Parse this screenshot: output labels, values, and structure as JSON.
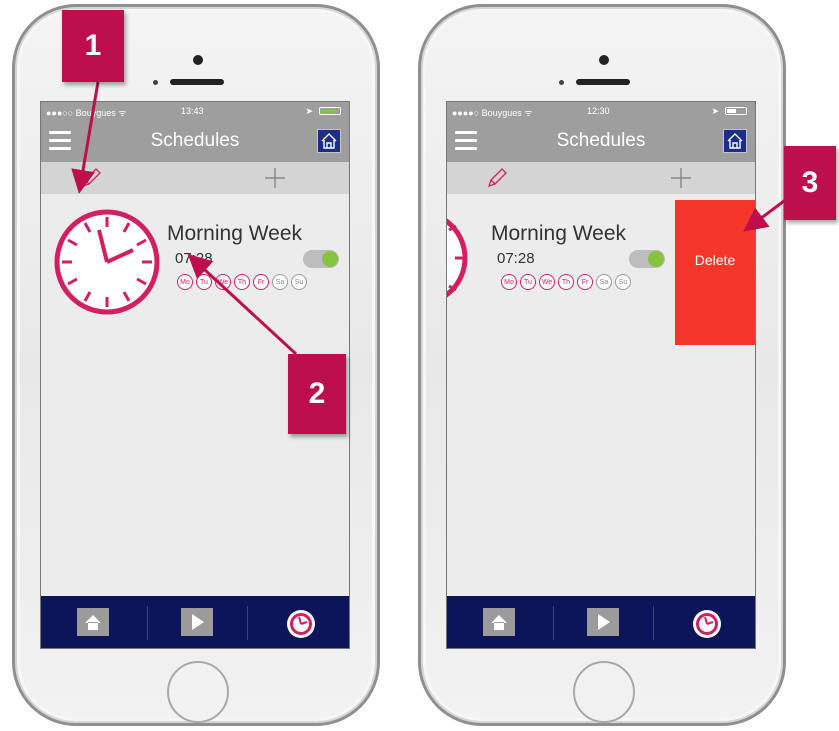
{
  "left_phone": {
    "status": {
      "carrier": "●●●○○ Bouygues ᯤ",
      "time": "13:43"
    },
    "header": {
      "title": "Schedules"
    },
    "schedule": {
      "name": "Morning Week",
      "time": "07:28",
      "enabled": true,
      "days": [
        {
          "label": "Mo",
          "active": true
        },
        {
          "label": "Tu",
          "active": true
        },
        {
          "label": "We",
          "active": true
        },
        {
          "label": "Th",
          "active": true
        },
        {
          "label": "Fr",
          "active": true
        },
        {
          "label": "Sa",
          "active": false
        },
        {
          "label": "Su",
          "active": false
        }
      ]
    }
  },
  "right_phone": {
    "status": {
      "carrier": "●●●●○ Bouygues ᯤ",
      "time": "12:30"
    },
    "header": {
      "title": "Schedules"
    },
    "schedule": {
      "name": "Morning Week",
      "time": "07:28",
      "enabled": true,
      "days": [
        {
          "label": "Mo",
          "active": true
        },
        {
          "label": "Tu",
          "active": true
        },
        {
          "label": "We",
          "active": true
        },
        {
          "label": "Th",
          "active": true
        },
        {
          "label": "Fr",
          "active": true
        },
        {
          "label": "Sa",
          "active": false
        },
        {
          "label": "Su",
          "active": false
        }
      ]
    },
    "delete_label": "Delete"
  },
  "callouts": {
    "c1": "1",
    "c2": "2",
    "c3": "3"
  },
  "colors": {
    "accent": "#d21f62",
    "callout": "#bd0f4b",
    "navbar": "#9e9e9e",
    "tabbar": "#0c155a",
    "delete": "#f5362b",
    "toggle_on": "#86c440"
  },
  "icons": [
    "hamburger-icon",
    "home-icon",
    "pencil-icon",
    "plus-icon",
    "clock-icon",
    "play-icon"
  ]
}
